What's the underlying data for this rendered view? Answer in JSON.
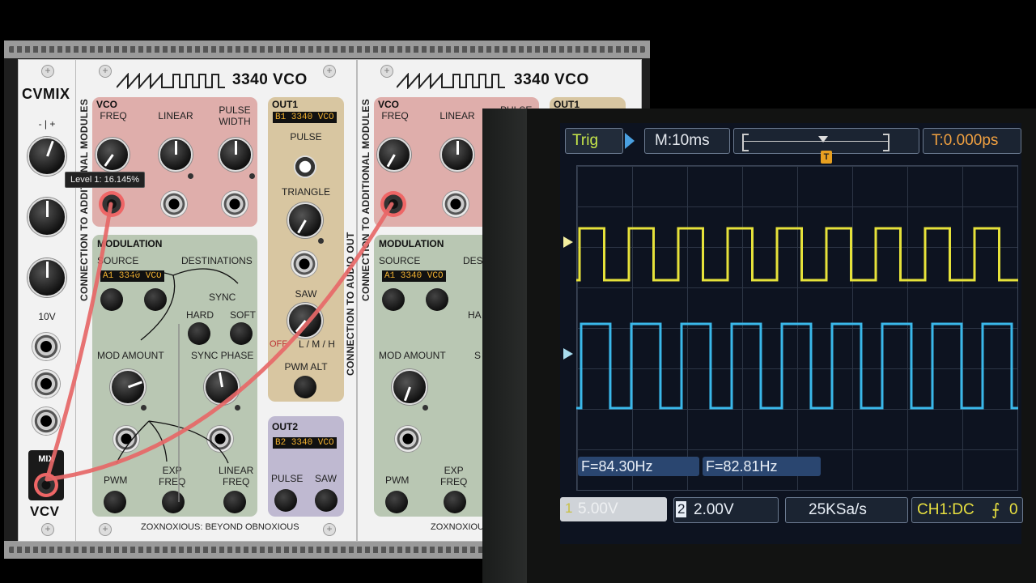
{
  "cvmix": {
    "title": "CVMIX",
    "top_label": "- | +",
    "voltage_label": "10V",
    "mix_label": "MIX",
    "brand": "VCV"
  },
  "tooltip": "Level 1: 16.145%",
  "module_a": {
    "title": "3340 VCO",
    "side_label": "CONNECTION TO ADDITIONAL MODULES",
    "vco_header": "VCO",
    "freq": "FREQ",
    "linear": "LINEAR",
    "pulse_width": "PULSE\nWIDTH",
    "mod_header": "MODULATION",
    "source": "SOURCE",
    "destinations": "DESTINATIONS",
    "source_value": "A1 3340 VCO",
    "sync": "SYNC",
    "hard": "HARD",
    "soft": "SOFT",
    "mod_amount": "MOD AMOUNT",
    "sync_phase": "SYNC PHASE",
    "pwm": "PWM",
    "exp_freq": "EXP\nFREQ",
    "linear_freq": "LINEAR\nFREQ",
    "footer": "ZOXNOXIOUS: BEYOND OBNOXIOUS"
  },
  "out1": {
    "header": "OUT1",
    "display": "B1 3340 VCO",
    "pulse": "PULSE",
    "triangle": "TRIANGLE",
    "saw": "SAW",
    "off": "OFF",
    "lmh": "L / M / H",
    "pwm_alt": "PWM ALT",
    "side_label": "CONNECTION TO AUDIO OUT"
  },
  "out2": {
    "header": "OUT2",
    "display": "B2 3340 VCO",
    "pulse": "PULSE",
    "saw": "SAW"
  },
  "module_b": {
    "title": "3340 VCO",
    "side_label": "CONNECTION TO ADDITIONAL MODULES",
    "vco_header": "VCO",
    "freq": "FREQ",
    "linear": "LINEAR",
    "pulse_partial": "PULSE",
    "mod_header": "MODULATION",
    "source": "SOURCE",
    "dest_partial": "DES",
    "source_value": "A1 3340 VCO",
    "hard_partial": "HA",
    "mod_amount": "MOD AMOUNT",
    "sync_partial": "S",
    "pwm": "PWM",
    "exp_freq": "EXP\nFREQ",
    "footer_partial": "ZOXNOXIOUS",
    "out1_header": "OUT1",
    "s_partial": "S"
  },
  "scope": {
    "trig": "Trig",
    "timebase": "M:10ms",
    "trigger_time": "T:0.000ps",
    "freq_ch1": "F=84.30Hz",
    "freq_ch2": "F=82.81Hz",
    "ch1_scale": "5.00V",
    "ch1_num": "1",
    "ch2_num": "2",
    "ch2_scale": "2.00V",
    "sample_rate": "25KSa/s",
    "coupling": "CH1:DC",
    "coupling_tail": "0",
    "trigger_marker": "T",
    "colors": {
      "ch1": "#e6e23a",
      "ch2": "#3ab8ea"
    }
  }
}
